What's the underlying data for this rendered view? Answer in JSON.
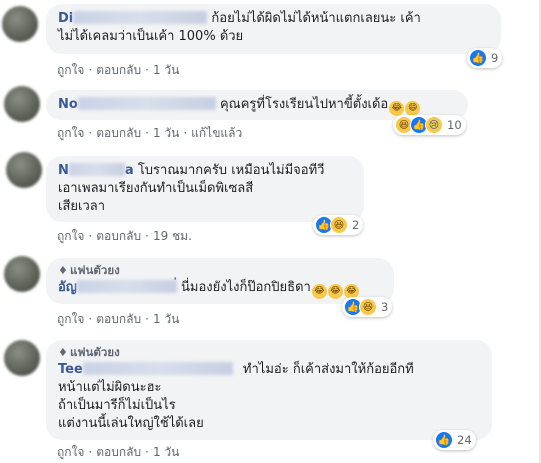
{
  "comments": [
    {
      "author_visible": "Di",
      "text_lines": [
        "ก้อยไม่ได้ผิดไม่ได้หน้าแตกเลยนะ เค้า",
        "ไม่ได้เคลมว่าเป็นเค้า 100% ด้วย"
      ],
      "reactions": [
        "like"
      ],
      "reaction_count": "9",
      "actions": {
        "like": "ถูกใจ",
        "reply": "ตอบกลับ",
        "time": "1 วัน"
      }
    },
    {
      "author_visible": "No",
      "text_lines": [
        "คุณครูที่โรงเรียนไปหาขี้ตั้งเด้อ"
      ],
      "reactions": [
        "haha",
        "like",
        "sad"
      ],
      "reaction_count": "10",
      "actions": {
        "like": "ถูกใจ",
        "reply": "ตอบกลับ",
        "time": "1 วัน",
        "edited": "แก้ไขแล้ว"
      }
    },
    {
      "author_visible": "N",
      "author_suffix": "a",
      "text_lines": [
        "โบราณมากครับ เหมือนไม่มีจอทีวี",
        "เอาเพลมาเรียงกันทำเป็นเม็ดพิเซลสี",
        "เสียเวลา"
      ],
      "reactions": [
        "like",
        "haha"
      ],
      "reaction_count": "2",
      "actions": {
        "like": "ถูกใจ",
        "reply": "ตอบกลับ",
        "time": "19 ชม."
      }
    },
    {
      "badge": "แฟนตัวยง",
      "author_visible": "อัญ",
      "author_suffix": "่",
      "text_lines": [
        "นี่มองยังไงก็ป๊อกปิยธิดา"
      ],
      "reactions": [
        "like",
        "haha"
      ],
      "reaction_count": "3",
      "actions": {
        "like": "ถูกใจ",
        "reply": "ตอบกลับ",
        "time": "1 วัน"
      }
    },
    {
      "badge": "แฟนตัวยง",
      "author_visible": "Tee",
      "text_lines": [
        "ทำไมอ่ะ ก็เค้าส่งมาให้ก้อยอีกที",
        "หน้าแต่ไม่ผิดนะฮะ",
        "ถ้าเป็นมารีก็ไม่เป็นไร",
        "แต่งานนี้เล่นใหญ่ใช้ได้เลย"
      ],
      "reactions": [
        "like"
      ],
      "reaction_count": "24",
      "actions": {
        "like": "ถูกใจ",
        "reply": "ตอบกลับ",
        "time": "1 วัน"
      }
    }
  ],
  "icons": {
    "like": "thumbs-up-icon",
    "haha": "laughing-face-icon",
    "sad": "sad-face-icon",
    "badge": "diamond-icon"
  },
  "colors": {
    "bubble": "#f2f3f5",
    "author": "#385898",
    "meta": "#606770",
    "like_blue": "#1877f2"
  }
}
